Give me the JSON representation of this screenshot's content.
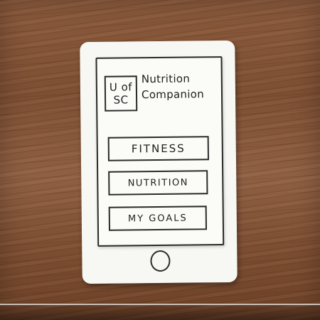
{
  "app": {
    "logo_line1": "U of",
    "logo_line2": "SC",
    "title_line1": "Nutrition",
    "title_line2": "Companion"
  },
  "menu": {
    "fitness_label": "FITNESS",
    "nutrition_label": "NUTRITION",
    "goals_label": "MY GOALS"
  },
  "colors": {
    "paper": "#f7f7f4",
    "ink": "#1f1f1f",
    "wood": "#7d4f33"
  },
  "icons": {
    "home": "home-button-icon"
  }
}
